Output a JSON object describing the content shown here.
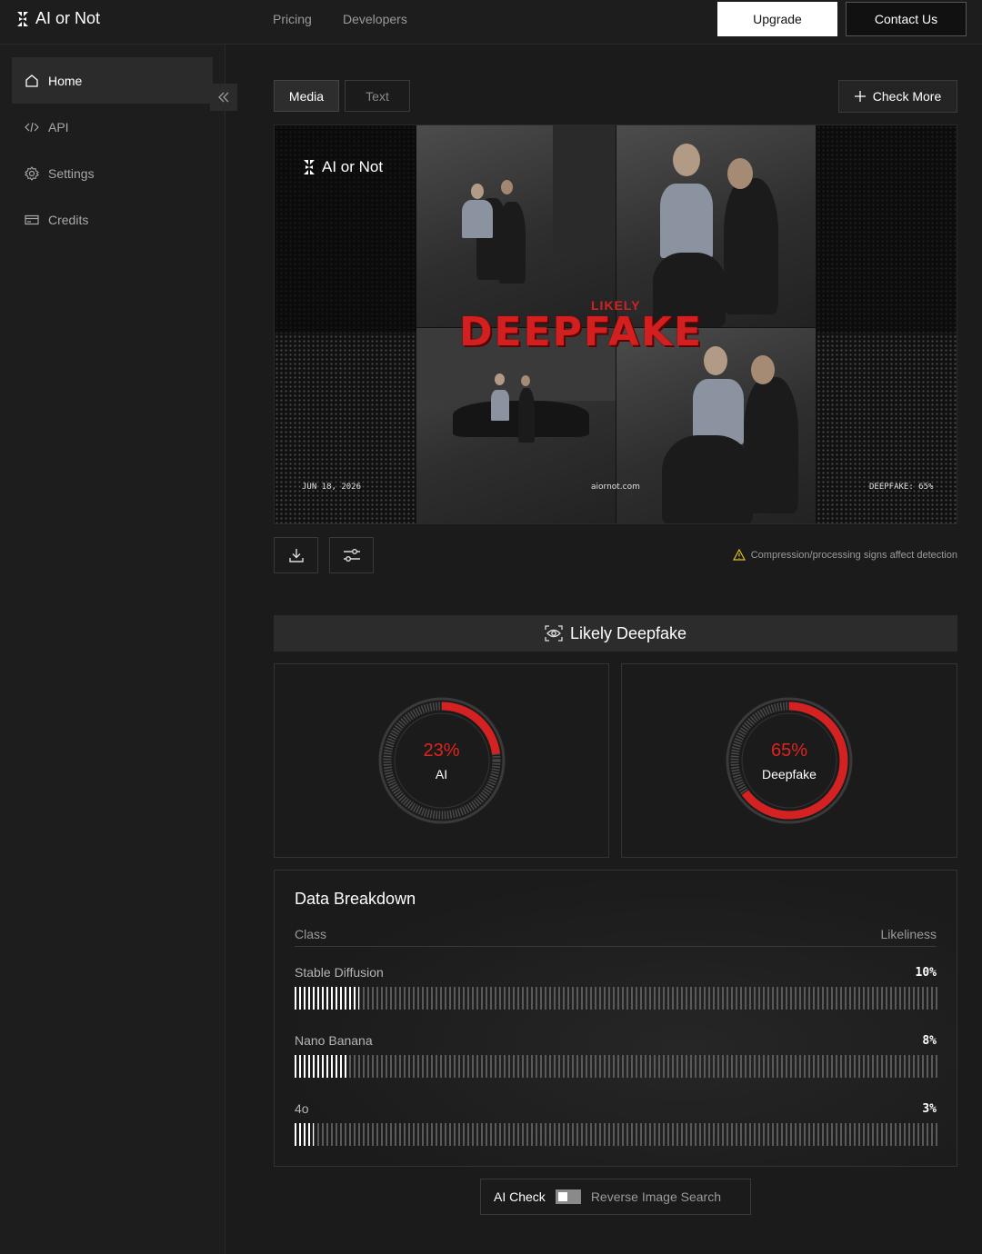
{
  "header": {
    "app_name": "AI or Not",
    "nav": [
      "Pricing",
      "Developers"
    ],
    "upgrade_label": "Upgrade",
    "contact_label": "Contact Us"
  },
  "sidebar": {
    "items": [
      {
        "label": "Home",
        "icon": "home-icon",
        "active": true
      },
      {
        "label": "API",
        "icon": "code-icon",
        "active": false
      },
      {
        "label": "Settings",
        "icon": "gear-icon",
        "active": false
      },
      {
        "label": "Credits",
        "icon": "credit-card-icon",
        "active": false
      }
    ]
  },
  "main": {
    "tabs": [
      {
        "label": "Media",
        "active": true
      },
      {
        "label": "Text",
        "active": false
      }
    ],
    "check_more_label": "Check More",
    "preview": {
      "logo_text": "AI or Not",
      "verdict_small": "LIKELY",
      "verdict_big": "DEEPFAKE",
      "date": "JUN 18, 2026",
      "site": "aiornot.com",
      "score_caption": "DEEPFAKE: 65%"
    },
    "warning_text": "Compression/processing signs affect detection",
    "result_title": "Likely Deepfake",
    "gauges": [
      {
        "percent": "23%",
        "label": "AI",
        "value": 0.23
      },
      {
        "percent": "65%",
        "label": "Deepfake",
        "value": 0.65
      }
    ],
    "breakdown": {
      "title": "Data Breakdown",
      "col_class": "Class",
      "col_likeliness": "Likeliness",
      "rows": [
        {
          "name": "Stable Diffusion",
          "percent": "10%",
          "value": 0.1
        },
        {
          "name": "Nano Banana",
          "percent": "8%",
          "value": 0.08
        },
        {
          "name": "4o",
          "percent": "3%",
          "value": 0.03
        }
      ]
    },
    "toggle": {
      "left_label": "AI Check",
      "right_label": "Reverse Image Search"
    }
  },
  "colors": {
    "accent_red": "#e0231f",
    "background": "#1b1b1b"
  }
}
